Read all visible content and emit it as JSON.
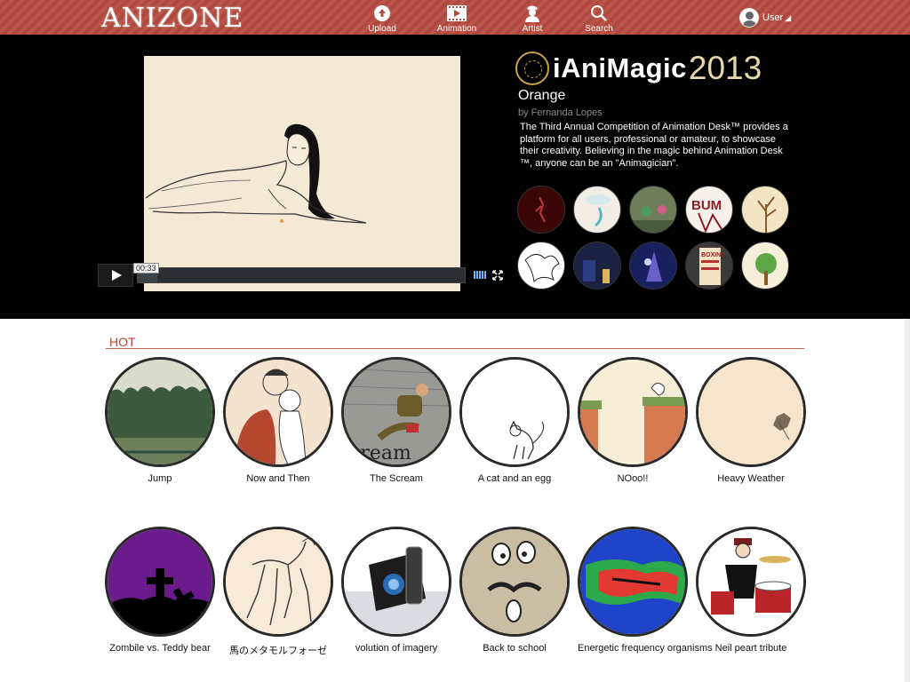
{
  "header": {
    "logo": "ANIZONE",
    "nav": [
      {
        "label": "Upload",
        "icon": "upload-icon"
      },
      {
        "label": "Animation",
        "icon": "film-icon"
      },
      {
        "label": "Artist",
        "icon": "artist-icon"
      },
      {
        "label": "Search",
        "icon": "search-icon"
      }
    ],
    "user_label": "User"
  },
  "hero": {
    "player": {
      "time": "00:33"
    },
    "contest_title": "iAniMagic",
    "contest_year": "2013",
    "film_title": "Orange",
    "film_author": "by Fernanda Lopes",
    "description": "The Third Annual Competition of Animation Desk™ provides a platform for all users, professional or amateur, to showcase their creativity. Believing in the magic behind Animation Desk ™, anyone can be an \"Animagician\".",
    "thumbnail_count": 10
  },
  "hot": {
    "title": "HOT",
    "items": [
      {
        "name": "Jump"
      },
      {
        "name": "Now and Then"
      },
      {
        "name": "The Scream"
      },
      {
        "name": "A cat and  an egg"
      },
      {
        "name": "NOoo!!"
      },
      {
        "name": "Heavy Weather"
      },
      {
        "name": "Zombile vs. Teddy bear"
      },
      {
        "name": "馬のメタモルフォーゼ"
      },
      {
        "name": "volution of imagery"
      },
      {
        "name": "Back to school"
      },
      {
        "name": "Energetic frequency organisms"
      },
      {
        "name": "Neil peart tribute"
      }
    ],
    "scream_text": "cream"
  },
  "colors": {
    "header": "#b54a3f",
    "accent": "#b84536",
    "hero_bg": "#000000"
  }
}
